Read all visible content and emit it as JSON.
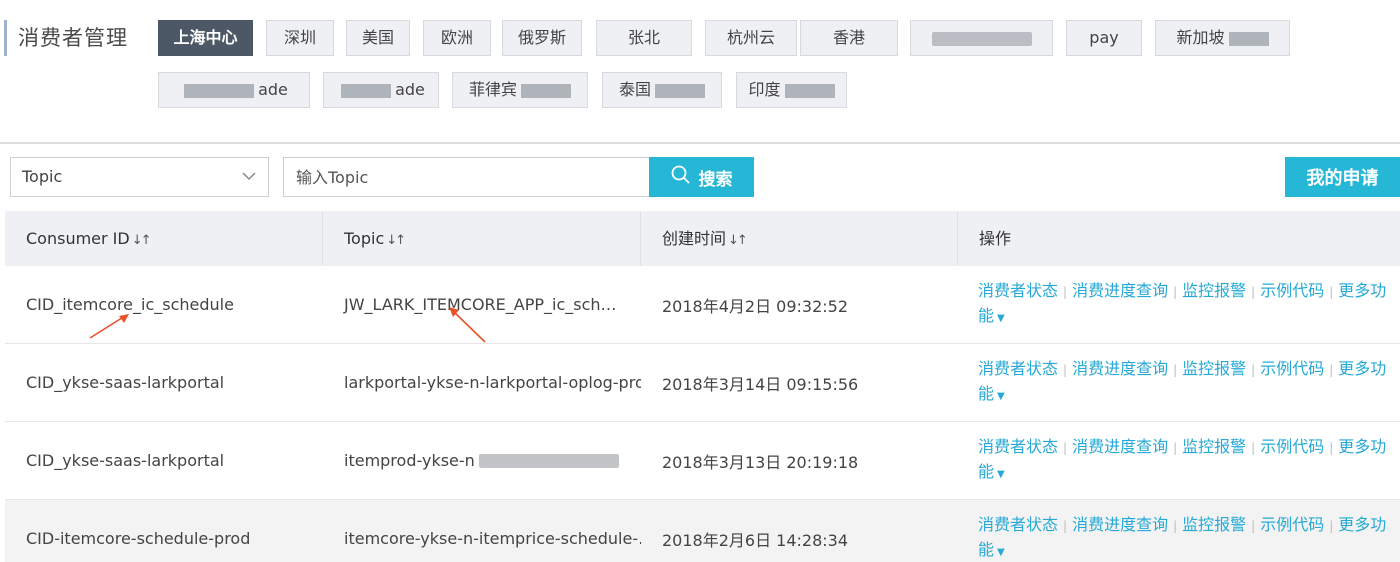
{
  "header": {
    "title": "消费者管理"
  },
  "region_tabs": [
    {
      "label": "上海中心",
      "active": true
    },
    {
      "label": "深圳"
    },
    {
      "label": "美国"
    },
    {
      "label": "欧洲"
    },
    {
      "label": "俄罗斯"
    },
    {
      "label": "张北"
    },
    {
      "label": "杭州云"
    },
    {
      "label": "香港"
    },
    {
      "label": ""
    },
    {
      "label": "pay"
    },
    {
      "label": "新加坡"
    },
    {
      "label": "ade"
    },
    {
      "label": "ade"
    },
    {
      "label": "菲律宾"
    },
    {
      "label": "泰国"
    },
    {
      "label": "印度"
    }
  ],
  "filter": {
    "select_value": "Topic",
    "input_placeholder": "输入Topic",
    "search_label": "搜索",
    "apply_label": "我的申请"
  },
  "table": {
    "columns": [
      "Consumer ID",
      "Topic",
      "创建时间",
      "操作"
    ],
    "sort_glyph": "↓↑",
    "rows": [
      {
        "consumer_id": "CID_itemcore_ic_schedule",
        "topic": "JW_LARK_ITEMCORE_APP_ic_sch…",
        "created": "2018年4月2日 09:32:52"
      },
      {
        "consumer_id": "CID_ykse-saas-larkportal",
        "topic": "larkportal-ykse-n-larkportal-oplog-prod",
        "created": "2018年3月14日 09:15:56"
      },
      {
        "consumer_id": "CID_ykse-saas-larkportal",
        "topic": "itemprod-ykse-n",
        "created": "2018年3月13日 20:19:18"
      },
      {
        "consumer_id": "CID-itemcore-schedule-prod",
        "topic": "itemcore-ykse-n-itemprice-schedule-…",
        "created": "2018年2月6日 14:28:34"
      }
    ],
    "actions": [
      "消费者状态",
      "消费进度查询",
      "监控报警",
      "示例代码",
      "更多功能"
    ]
  },
  "colors": {
    "accent": "#26b7d6",
    "link": "#26a9d6",
    "annotation": "#e8522a"
  }
}
